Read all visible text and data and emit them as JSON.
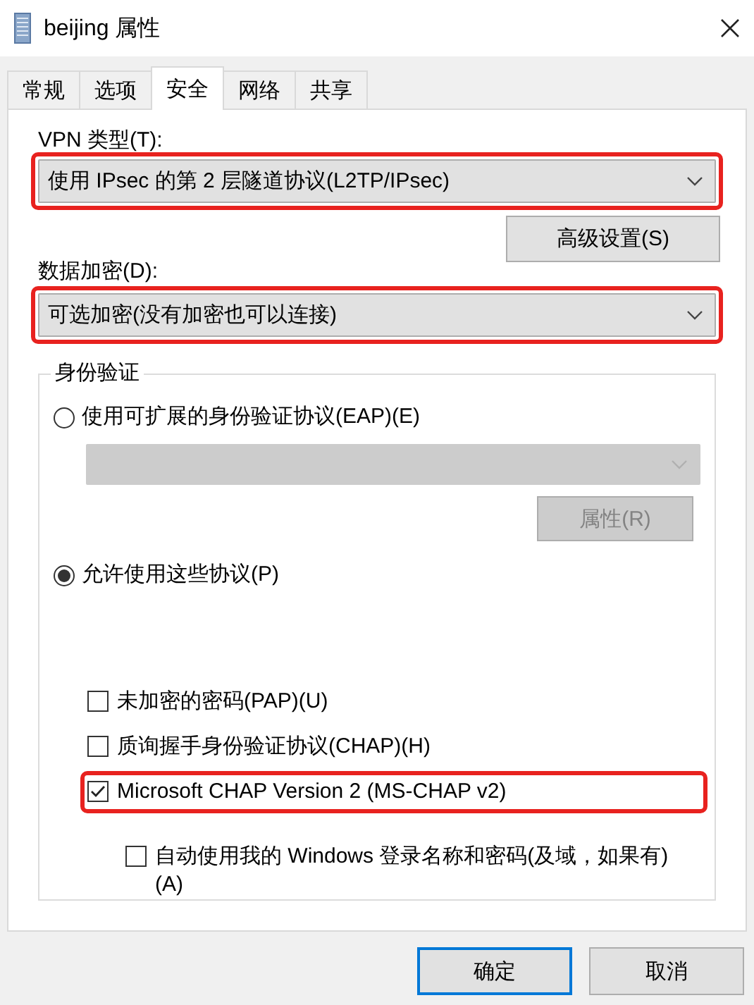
{
  "window": {
    "title": "beijing 属性"
  },
  "tabs": [
    {
      "label": "常规",
      "selected": false
    },
    {
      "label": "选项",
      "selected": false
    },
    {
      "label": "安全",
      "selected": true
    },
    {
      "label": "网络",
      "selected": false
    },
    {
      "label": "共享",
      "selected": false
    }
  ],
  "vpn_type": {
    "label": "VPN 类型(T):",
    "value": "使用 IPsec 的第 2 层隧道协议(L2TP/IPsec)",
    "highlighted": true,
    "disabled": false
  },
  "advanced_button": {
    "label": "高级设置(S)",
    "disabled": false
  },
  "data_encryption": {
    "label": "数据加密(D):",
    "value": "可选加密(没有加密也可以连接)",
    "highlighted": true,
    "disabled": false
  },
  "authentication": {
    "title": "身份验证",
    "options": [
      {
        "label": "使用可扩展的身份验证协议(EAP)(E)",
        "selected": false
      },
      {
        "label": "允许使用这些协议(P)",
        "selected": true
      }
    ],
    "eap_dropdown": {
      "disabled": true
    },
    "properties_button": {
      "label": "属性(R)",
      "disabled": true
    },
    "protocols": [
      {
        "label": "未加密的密码(PAP)(U)",
        "checked": false,
        "highlighted": false
      },
      {
        "label": "质询握手身份验证协议(CHAP)(H)",
        "checked": false,
        "highlighted": false
      },
      {
        "label": "Microsoft CHAP Version 2 (MS-CHAP v2)",
        "checked": true,
        "highlighted": true,
        "children": [
          {
            "label": "自动使用我的 Windows 登录名称和密码(及域，如果有)(A)",
            "checked": false,
            "highlighted": false
          }
        ]
      }
    ]
  },
  "buttons": [
    {
      "label": "确定",
      "default": true
    },
    {
      "label": "取消",
      "default": false
    }
  ]
}
